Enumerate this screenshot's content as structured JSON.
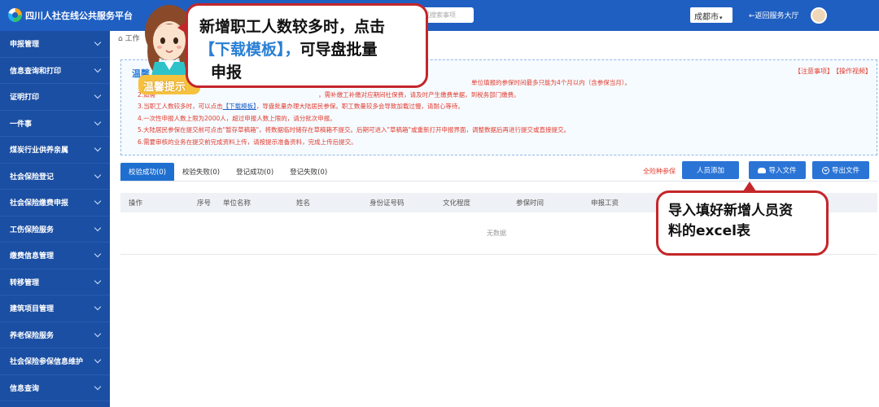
{
  "header": {
    "app_title": "四川人社在线公共服务平台",
    "search_placeholder": "或搜索事项",
    "city": "成都市",
    "back_link": "←返回服务大厅"
  },
  "sidebar": {
    "items": [
      {
        "label": "申报管理"
      },
      {
        "label": "信息查询和打印"
      },
      {
        "label": "证明打印"
      },
      {
        "label": "一件事"
      },
      {
        "label": "煤炭行业供养亲属"
      },
      {
        "label": "社会保险登记"
      },
      {
        "label": "社会保险缴费申报"
      },
      {
        "label": "工伤保险服务"
      },
      {
        "label": "缴费信息管理"
      },
      {
        "label": "转移管理"
      },
      {
        "label": "建筑项目管理"
      },
      {
        "label": "养老保险服务"
      },
      {
        "label": "社会保险参保信息维护"
      },
      {
        "label": "信息查询"
      }
    ]
  },
  "breadcrumb": "⌂ 工作",
  "tips": {
    "title": "温馨",
    "notice_link": "【注意事项】",
    "guide_link": "【操作视频】",
    "line1": "单位填报的参保时间最多只能为4个月以内（含参保当月）。",
    "line2a": "2.如需",
    "line2b": "，需补缴工补缴对应期间社保费，请及时产生缴费单据，到税务部门缴费。",
    "line3a": "3.当职工人数较多时，可以点击",
    "line3_link": "【下载模板】",
    "line3b": "，导盘批量办理大陆居民参保。职工数量较多会导致加载过慢，请耐心等待。",
    "line4": "4.一次性申报人数上限为2000人，超过申报人数上限的，请分批次申报。",
    "line5": "5.大陆居民参保在提交前可点击\"暂存草稿箱\"，将数据临时储存在草稿箱不提交。后期可进入\"草稿箱\"或重新打开申报界面，调整数据后再进行提交或直接提交。",
    "line6": "6.需要审核的业务在提交前完成资料上传，请按提示准备资料，完成上传后提交。"
  },
  "tabs": [
    {
      "label": "校验成功(0)"
    },
    {
      "label": "校验失败(0)"
    },
    {
      "label": "登记成功(0)"
    },
    {
      "label": "登记失败(0)"
    }
  ],
  "actions": {
    "all_insurance": "全险种参保",
    "add_person": "人员添加",
    "import_file": "导入文件",
    "export_file": "导出文件"
  },
  "table": {
    "columns": [
      "操作",
      "序号",
      "单位名称",
      "姓名",
      "身份证号码",
      "文化程度",
      "参保时间",
      "申报工资"
    ],
    "empty_text": "无数据"
  },
  "callouts": {
    "bubble1_line1": "新增职工人数较多时，点击",
    "bubble1_highlight": "【下载模板】，",
    "bubble1_line2_rest": "可导盘批量",
    "bubble1_line3": "申报",
    "bubble2_line1": "导入填好新增人员资",
    "bubble2_line2": "料的excel表",
    "badge": "温馨提示"
  },
  "colors": {
    "header_bg": "#1f5fc2",
    "sidebar_bg": "#1b4fa3",
    "accent_button": "#2a74d6",
    "warning_text": "#e23b2e",
    "callout_border": "#c4262a"
  }
}
